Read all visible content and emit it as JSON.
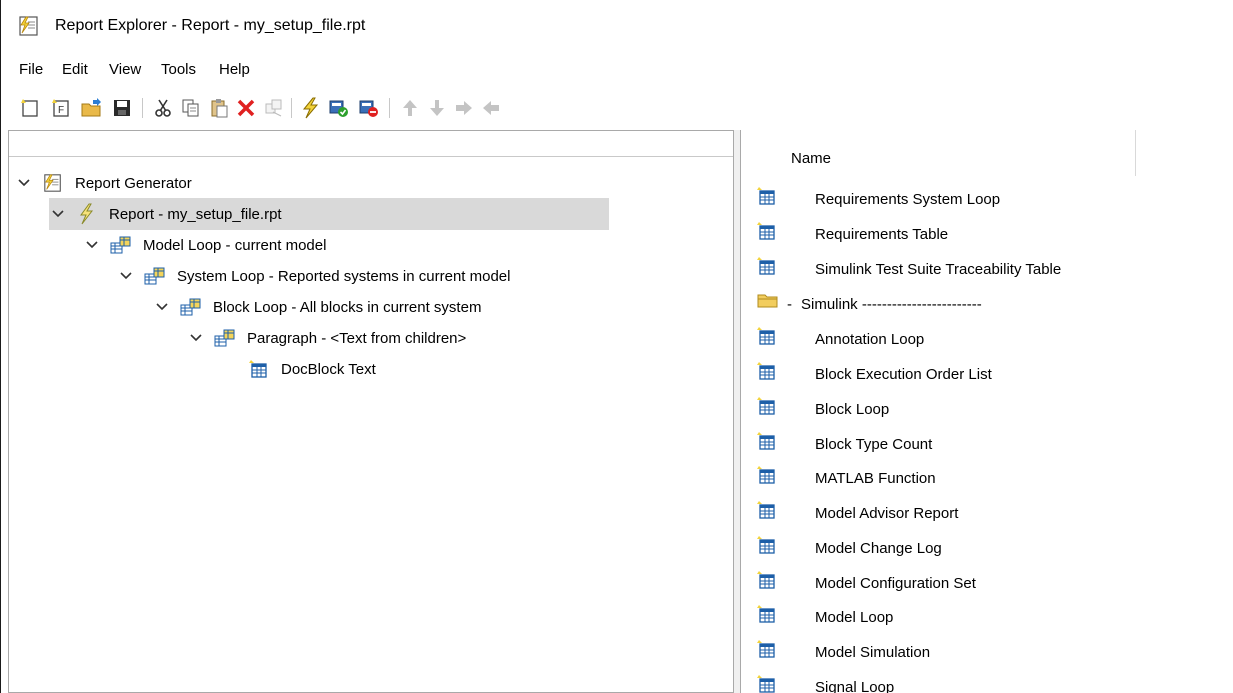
{
  "window": {
    "title": "Report Explorer - Report - my_setup_file.rpt"
  },
  "menu": [
    "File",
    "Edit",
    "View",
    "Tools",
    "Help"
  ],
  "toolbar": {
    "buttons": [
      "new-report-icon",
      "new-form-icon",
      "open-icon",
      "save-icon",
      "cut-icon",
      "copy-icon",
      "paste-icon",
      "delete-icon",
      "duplicate-icon",
      "run-report-icon",
      "activate-icon",
      "deactivate-icon",
      "move-up-icon",
      "move-down-icon",
      "demote-icon",
      "promote-icon"
    ]
  },
  "tree": [
    {
      "label": "Report Generator",
      "icon": "report-generator-icon",
      "expanded": true
    },
    {
      "label": "Report - my_setup_file.rpt",
      "icon": "report-icon",
      "expanded": true,
      "selected": true
    },
    {
      "label": "Model Loop - current model",
      "icon": "loop-component-icon",
      "expanded": true
    },
    {
      "label": "System Loop - Reported systems in current model",
      "icon": "loop-component-icon",
      "expanded": true
    },
    {
      "label": "Block Loop - All blocks in current system",
      "icon": "loop-component-icon",
      "expanded": true
    },
    {
      "label": "Paragraph - <Text from children>",
      "icon": "loop-component-icon",
      "expanded": true
    },
    {
      "label": "DocBlock Text",
      "icon": "table-component-icon",
      "expanded": false
    }
  ],
  "library": {
    "column_header": "Name",
    "items": [
      {
        "label": "Requirements System Loop",
        "icon": "table-component-icon"
      },
      {
        "label": "Requirements Table",
        "icon": "table-component-icon"
      },
      {
        "label": "Simulink Test Suite Traceability Table",
        "icon": "table-component-icon"
      },
      {
        "label": "Simulink ------------------------",
        "icon": "folder-icon",
        "prefix": "-"
      },
      {
        "label": "Annotation Loop",
        "icon": "table-component-icon"
      },
      {
        "label": "Block Execution Order List",
        "icon": "table-component-icon"
      },
      {
        "label": "Block Loop",
        "icon": "table-component-icon"
      },
      {
        "label": "Block Type Count",
        "icon": "table-component-icon"
      },
      {
        "label": "MATLAB Function",
        "icon": "table-component-icon"
      },
      {
        "label": "Model Advisor Report",
        "icon": "table-component-icon"
      },
      {
        "label": "Model Change Log",
        "icon": "table-component-icon"
      },
      {
        "label": "Model Configuration Set",
        "icon": "table-component-icon"
      },
      {
        "label": "Model Loop",
        "icon": "table-component-icon"
      },
      {
        "label": "Model Simulation",
        "icon": "table-component-icon"
      },
      {
        "label": "Signal Loop",
        "icon": "table-component-icon"
      }
    ]
  }
}
